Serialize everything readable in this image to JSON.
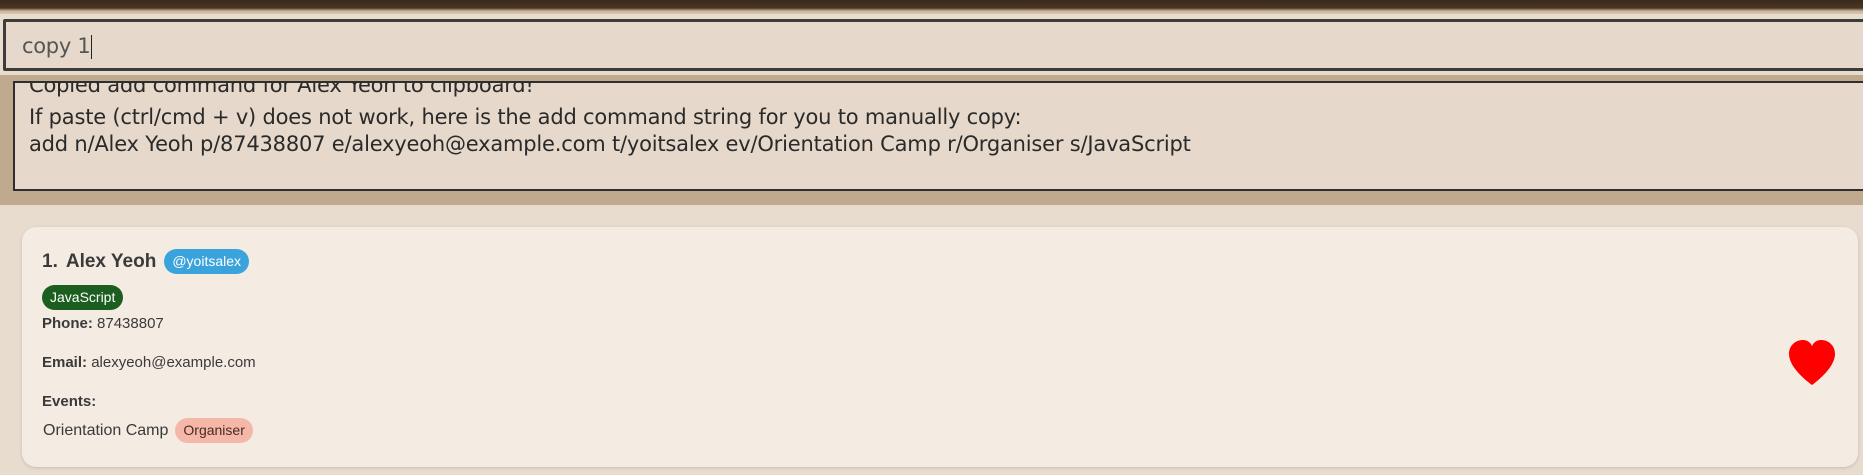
{
  "command": {
    "value": "copy 1"
  },
  "result": {
    "lines": [
      "Copied add command for Alex Yeoh to clipboard!",
      "If paste (ctrl/cmd + v) does not work, here is the add command string for you to manually copy:",
      "add n/Alex Yeoh p/87438807 e/alexyeoh@example.com t/yoitsalex ev/Orientation Camp r/Organiser s/JavaScript"
    ]
  },
  "person": {
    "index": "1.",
    "name": "Alex Yeoh",
    "handle": "@yoitsalex",
    "skill": "JavaScript",
    "phone_label": "Phone:",
    "phone": "87438807",
    "email_label": "Email:",
    "email": "alexyeoh@example.com",
    "events_label": "Events:",
    "event_name": "Orientation Camp",
    "event_role": "Organiser",
    "favourite_icon": "heart-icon"
  },
  "colors": {
    "handle_tag": "#3aa3dc",
    "skill_tag": "#1b5e20",
    "role_tag": "#f5b8a8",
    "heart": "#ff0000"
  }
}
